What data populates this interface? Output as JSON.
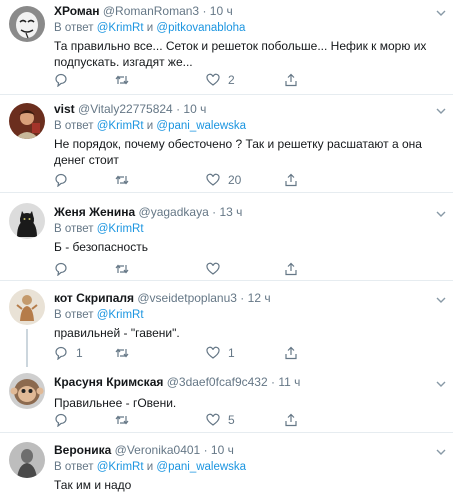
{
  "tweets": [
    {
      "name": "ХРоман",
      "handle": "@RomanRoman3",
      "time": "10 ч",
      "reply_prefix": "В ответ",
      "reply_to": [
        "@KrimRt",
        "@pitkovanabloha"
      ],
      "reply_sep": "и",
      "text": "Та правильно все... Сеток и решеток побольше... Нефик к морю их подпускать. изгадят же...",
      "replies": "",
      "retweets": "",
      "likes": "2",
      "avatar": "mask-avatar"
    },
    {
      "name": "vist",
      "handle": "@Vitaly22775824",
      "time": "10 ч",
      "reply_prefix": "В ответ",
      "reply_to": [
        "@KrimRt",
        "@pani_walewska"
      ],
      "reply_sep": "и",
      "text": "Не порядок, почему обесточено ? Так и решетку расшатают а она денег стоит",
      "replies": "",
      "retweets": "",
      "likes": "20",
      "avatar": "portrait-avatar"
    },
    {
      "name": "Женя Женина",
      "handle": "@yagadkaya",
      "time": "13 ч",
      "reply_prefix": "В ответ",
      "reply_to": [
        "@KrimRt"
      ],
      "reply_sep": "",
      "text": "Б - безопасность",
      "replies": "",
      "retweets": "",
      "likes": "",
      "avatar": "cat-avatar"
    },
    {
      "name": "кот Скрипаля",
      "handle": "@vseidetpoplanu3",
      "time": "12 ч",
      "reply_prefix": "В ответ",
      "reply_to": [
        "@KrimRt"
      ],
      "reply_sep": "",
      "text": "правильней - \"гавени\".",
      "replies": "1",
      "retweets": "",
      "likes": "1",
      "avatar": "figure-avatar"
    },
    {
      "name": "Красуня Кримская",
      "handle": "@3daef0fcaf9c432",
      "time": "11 ч",
      "reply_prefix": "",
      "reply_to": [],
      "reply_sep": "",
      "text": "Правильнее - гОвени.",
      "replies": "",
      "retweets": "",
      "likes": "5",
      "avatar": "monkey-avatar"
    },
    {
      "name": "Вероника",
      "handle": "@Veronika0401",
      "time": "10 ч",
      "reply_prefix": "В ответ",
      "reply_to": [
        "@KrimRt",
        "@pani_walewska"
      ],
      "reply_sep": "и",
      "text": "Так им и надо",
      "replies": "",
      "retweets": "",
      "likes": "",
      "avatar": "grey-avatar"
    }
  ],
  "separator": "·",
  "colors": {
    "link": "#1b95e0",
    "muted": "#657786",
    "text": "#14171a",
    "border": "#e6ecf0"
  }
}
